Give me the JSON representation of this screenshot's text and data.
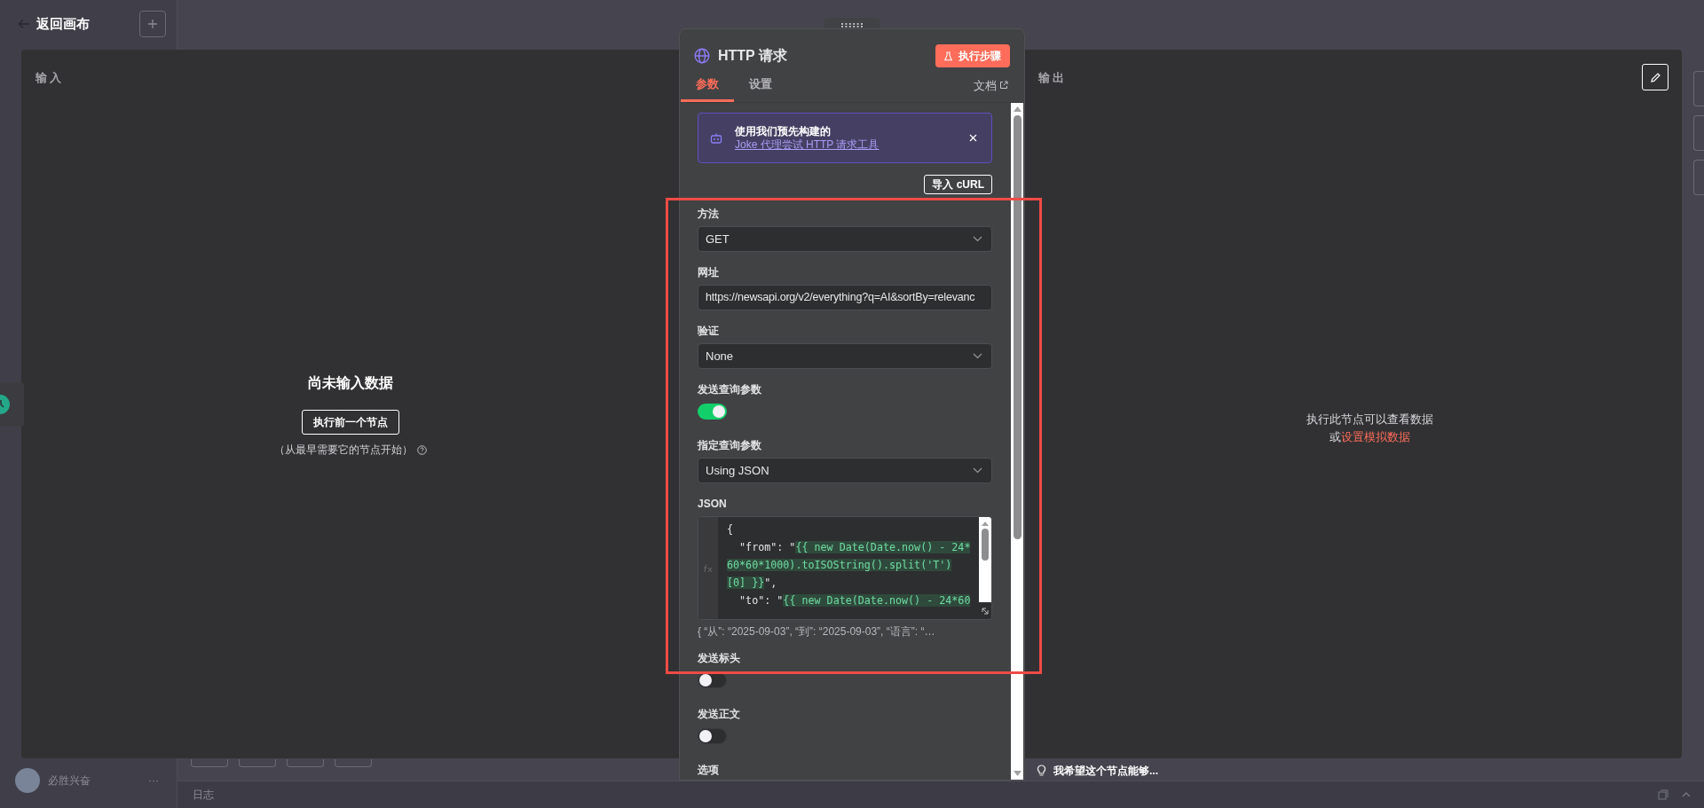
{
  "top_bar": {
    "back_label": "返回画布"
  },
  "input_pane": {
    "title": "输入",
    "empty_title": "尚未输入数据",
    "button": "执行前一个节点",
    "hint": "（从最早需要它的节点开始）"
  },
  "output_pane": {
    "title": "输出",
    "message": "执行此节点可以查看数据",
    "alt_prefix": "或",
    "alt_link": "设置模拟数据"
  },
  "node_panel": {
    "title": "HTTP 请求",
    "run_button": "执行步骤",
    "tabs": [
      {
        "label": "参数",
        "selected": true
      },
      {
        "label": "设置",
        "selected": false
      }
    ],
    "docs_link": "文档",
    "banner": {
      "text": "使用我们预先构建的 ",
      "link": "Joke 代理尝试 HTTP 请求工具"
    },
    "import_button": "导入 cURL",
    "fields": [
      {
        "kind": "select",
        "label": "方法",
        "value": "GET"
      },
      {
        "kind": "input",
        "label": "网址",
        "value": "https://newsapi.org/v2/everything?q=AI&sortBy=relevanc"
      },
      {
        "kind": "select",
        "label": "验证",
        "value": "None"
      },
      {
        "kind": "toggle",
        "label": "发送查询参数",
        "on": true
      },
      {
        "kind": "select",
        "label": "指定查询参数",
        "value": "Using JSON"
      },
      {
        "kind": "code",
        "label": "JSON",
        "lines": [
          [
            {
              "text": "{",
              "kind": "plain"
            }
          ],
          [
            {
              "text": "  \"from\": \"",
              "kind": "plain"
            },
            {
              "text": "{{ new Date(Date.now() - 24*",
              "kind": "expression"
            }
          ],
          [
            {
              "text": "60*60*1000).toISOString().split('T')",
              "kind": "expression"
            }
          ],
          [
            {
              "text": "[0] }}",
              "kind": "expression"
            },
            {
              "text": "\",",
              "kind": "plain"
            }
          ],
          [
            {
              "text": "  \"to\": \"",
              "kind": "plain"
            },
            {
              "text": "{{ new Date(Date.now() - 24*60",
              "kind": "expression"
            }
          ]
        ],
        "hint": "{ “从”: “2025-09-03”, “到”: “2025-09-03”, “语言”: “…"
      },
      {
        "kind": "toggle",
        "label": "发送标头",
        "on": false
      },
      {
        "kind": "toggle",
        "label": "发送正文",
        "on": false
      },
      {
        "kind": "heading",
        "label": "选项"
      }
    ]
  },
  "footer": {
    "user": "必胜兴奋",
    "more": "···",
    "log_label": "日志",
    "feedback": "我希望这个节点能够..."
  }
}
